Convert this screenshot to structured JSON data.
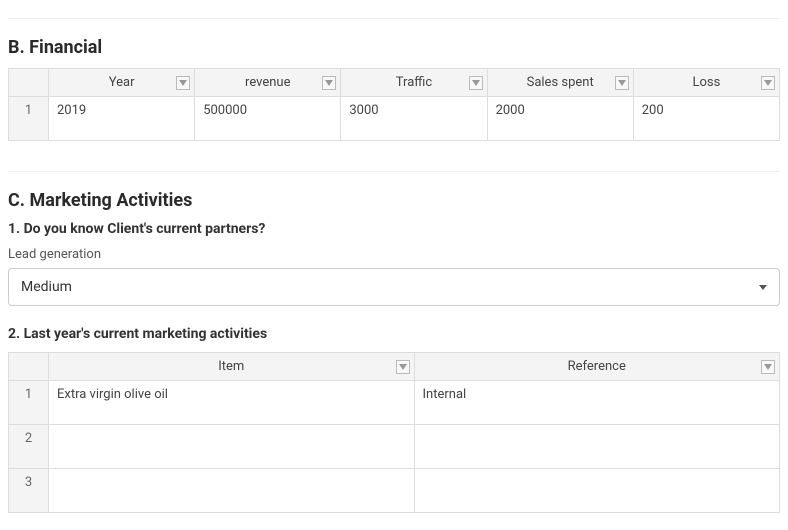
{
  "sectionB": {
    "title": "B. Financial",
    "headers": [
      "Year",
      "revenue",
      "Traffic",
      "Sales spent",
      "Loss"
    ],
    "rows": [
      {
        "num": "1",
        "cells": [
          "2019",
          "500000",
          "3000",
          "2000",
          "200"
        ]
      }
    ]
  },
  "sectionC": {
    "title": "C. Marketing Activities",
    "q1": {
      "title": "1. Do you know Client's current partners?",
      "field_label": "Lead generation",
      "selected": "Medium"
    },
    "q2": {
      "title": "2. Last year's current marketing activities",
      "headers": [
        "Item",
        "Reference"
      ],
      "rows": [
        {
          "num": "1",
          "cells": [
            "Extra virgin olive oil",
            "Internal"
          ]
        },
        {
          "num": "2",
          "cells": [
            "",
            ""
          ]
        },
        {
          "num": "3",
          "cells": [
            "",
            ""
          ]
        }
      ]
    }
  }
}
